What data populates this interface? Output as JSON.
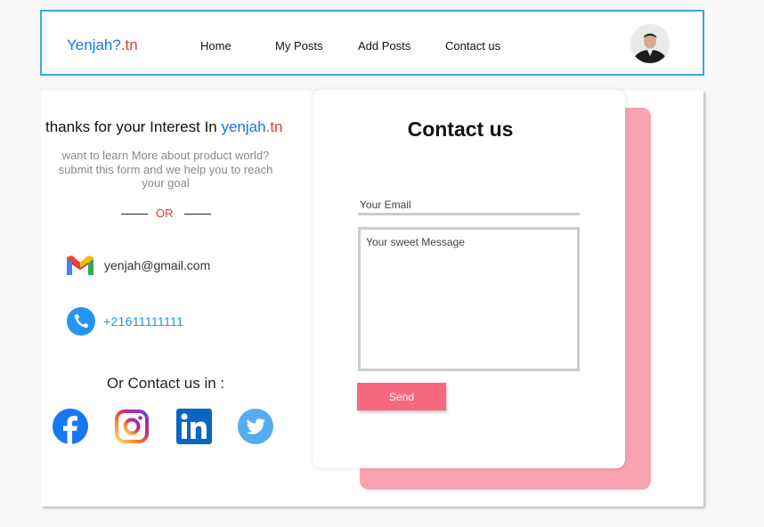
{
  "nav": {
    "logo_part1": "Yenjah?",
    "logo_part2": ".tn",
    "links": [
      "Home",
      "My Posts",
      "Add Posts",
      "Contact us"
    ]
  },
  "left": {
    "thanks_text": "thanks for your Interest In ",
    "brand_part1": "yenjah",
    "brand_part2": ".tn",
    "subtitle": "want to learn More about product world? submit this form and we help you to reach your goal",
    "or_label": "OR",
    "email": "yenjah@gmail.com",
    "phone": "+21611111111",
    "contact_in": "Or Contact us in :",
    "socials": [
      "facebook-icon",
      "instagram-icon",
      "linkedin-icon",
      "twitter-icon"
    ]
  },
  "form": {
    "title": "Contact us",
    "email_placeholder": "Your Email",
    "message_placeholder": "Your sweet Message",
    "send_label": "Send"
  },
  "colors": {
    "nav_border": "#3da6e3",
    "brand_blue": "#1a73e8",
    "brand_red": "#e53935",
    "pink_accent": "#f8a3b0",
    "send_button": "#f8687f"
  }
}
